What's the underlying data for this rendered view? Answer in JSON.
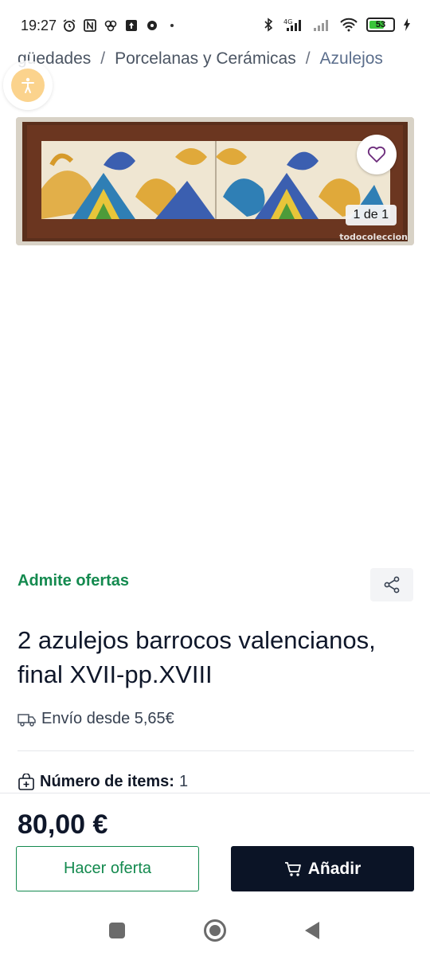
{
  "status_bar": {
    "time": "19:27",
    "battery_level": "53",
    "network": "4G",
    "left_icons": [
      "alarm-icon",
      "nfc-icon",
      "app-icon",
      "upload-icon",
      "chat-icon"
    ],
    "right_icons": [
      "bluetooth-icon",
      "signal-icon",
      "signal-alt-icon",
      "wifi-icon",
      "battery-icon",
      "charging-icon"
    ]
  },
  "breadcrumb": {
    "items": [
      "güedades",
      "Porcelanas y Cerámicas",
      "Azulejos"
    ],
    "separator": "/"
  },
  "product": {
    "image_counter": "1 de 1",
    "watermark": "todocoleccion",
    "offers_label": "Admite ofertas",
    "title": "2 azulejos barrocos valencianos, final XVII-pp.XVIII",
    "shipping": "Envío desde 5,65€",
    "items_label": "Número de items:",
    "items_value": "1",
    "price": "80,00 €"
  },
  "actions": {
    "offer_button": "Hacer oferta",
    "add_button": "Añadir"
  },
  "colors": {
    "accent_green": "#148a4f",
    "dark_button": "#0b1426",
    "a11y_button": "#fbd38d",
    "heart": "#6b2a7a"
  }
}
